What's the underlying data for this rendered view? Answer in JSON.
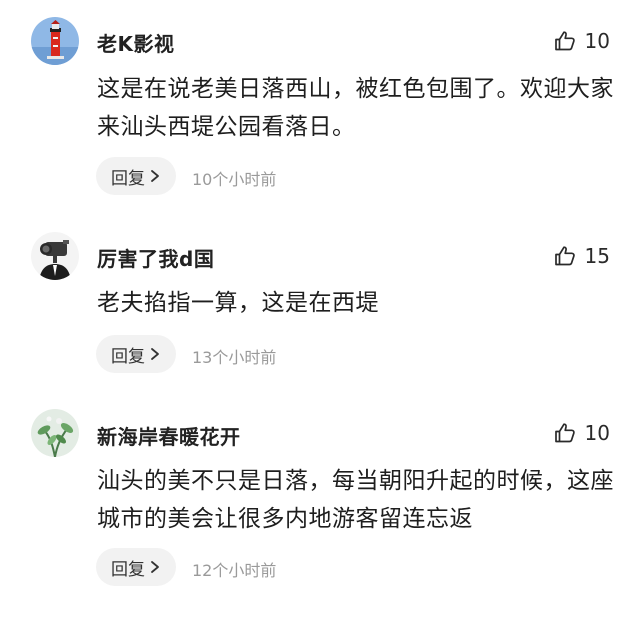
{
  "colors": {
    "background": "#ffffff",
    "reply_bg": "#f2f2f2",
    "time_text": "#9a9a9a"
  },
  "comments": [
    {
      "avatar_icon": "lighthouse-avatar-icon",
      "username": "老K影视",
      "likes": "10",
      "text": "这是在说老美日落西山，被红色包围了。欢迎大家来汕头西堤公园看落日。",
      "reply_label": "回复",
      "time": "10个小时前"
    },
    {
      "avatar_icon": "camera-head-avatar-icon",
      "username": "厉害了我d国",
      "likes": "15",
      "text": "老夫掐指一算，这是在西堤",
      "reply_label": "回复",
      "time": "13个小时前"
    },
    {
      "avatar_icon": "plant-avatar-icon",
      "username": "新海岸春暖花开",
      "likes": "10",
      "text": "汕头的美不只是日落，每当朝阳升起的时候，这座城市的美会让很多内地游客留连忘返",
      "reply_label": "回复",
      "time": "12个小时前"
    }
  ]
}
